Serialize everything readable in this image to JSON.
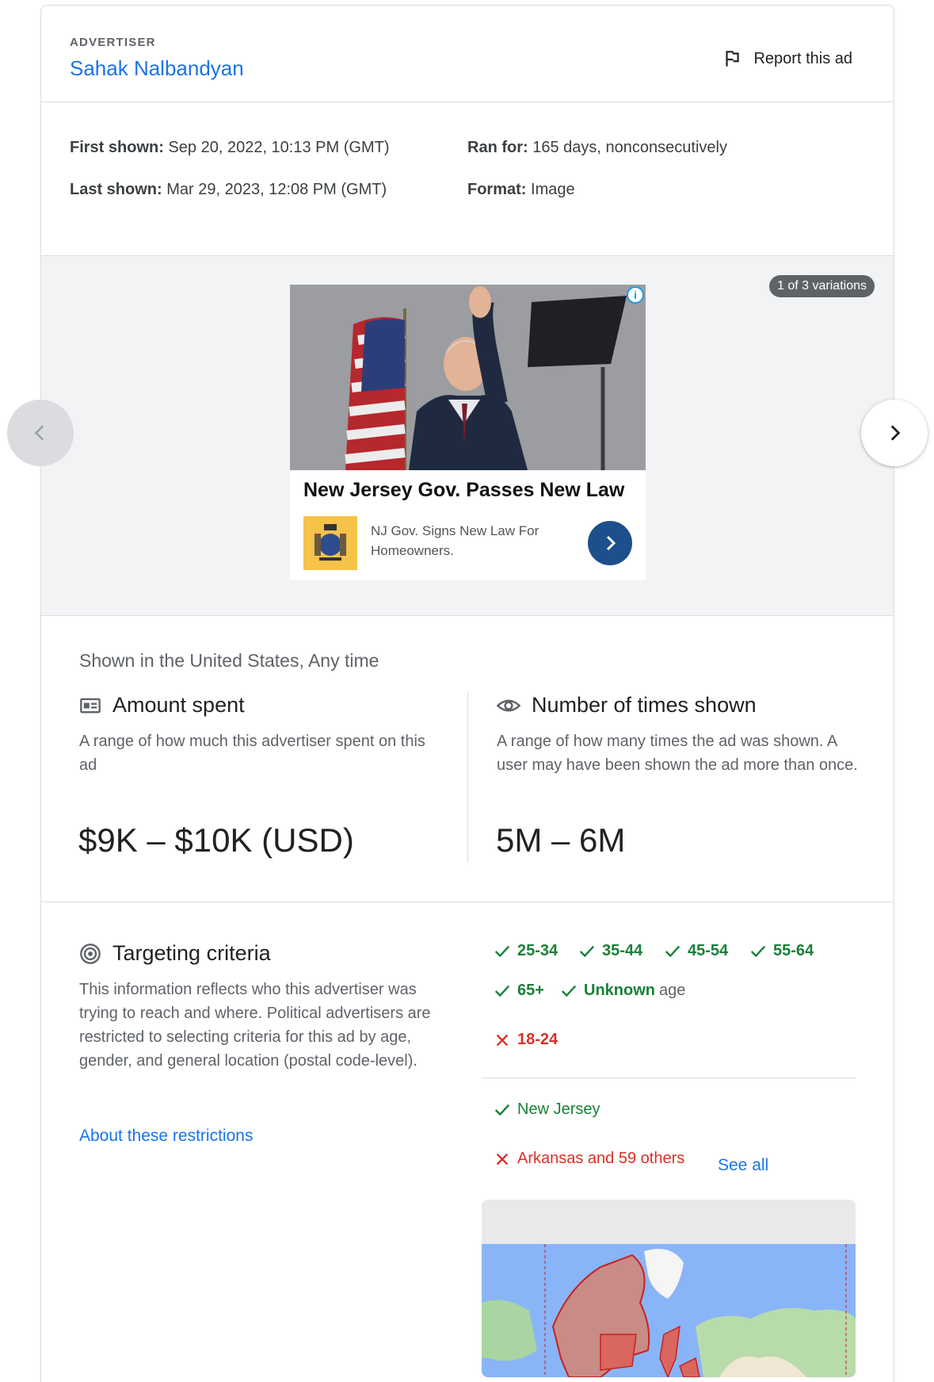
{
  "header": {
    "advertiser_label": "ADVERTISER",
    "advertiser_name": "Sahak Nalbandyan",
    "report_label": "Report this ad"
  },
  "meta": {
    "first_shown_label": "First shown:",
    "first_shown_value": "Sep 20, 2022, 10:13 PM (GMT)",
    "last_shown_label": "Last shown:",
    "last_shown_value": "Mar 29, 2023, 12:08 PM (GMT)",
    "ran_for_label": "Ran for:",
    "ran_for_value": "165 days, nonconsecutively",
    "format_label": "Format:",
    "format_value": "Image"
  },
  "preview": {
    "variations_badge": "1 of 3 variations",
    "ad_headline": "New Jersey Gov. Passes New Law",
    "ad_subtext": "NJ Gov. Signs New Law For Homeowners.",
    "info_glyph": "i"
  },
  "stats": {
    "shown_in": "Shown in the United States, Any time",
    "amount_title": "Amount spent",
    "amount_desc": "A range of how much this advertiser spent on this ad",
    "amount_value": "$9K – $10K (USD)",
    "times_title": "Number of times shown",
    "times_desc": "A range of how many times the ad was shown. A user may have been shown the ad more than once.",
    "times_value": "5M – 6M"
  },
  "targeting": {
    "title": "Targeting criteria",
    "description": "This information reflects who this advertiser was trying to reach and where. Political advertisers are restricted to selecting criteria for this ad by age, gender, and general location (postal code-level).",
    "restrictions_link": "About these restrictions",
    "age_included": [
      "25-34",
      "35-44",
      "45-54",
      "55-64",
      "65+"
    ],
    "unknown_age_bold": "Unknown",
    "unknown_age_light": "age",
    "age_excluded": "18-24",
    "location_included": "New Jersey",
    "location_excluded": "Arkansas and 59 others",
    "see_all": "See all"
  },
  "colors": {
    "link": "#1a73e8",
    "included": "#188038",
    "excluded": "#d93025"
  }
}
